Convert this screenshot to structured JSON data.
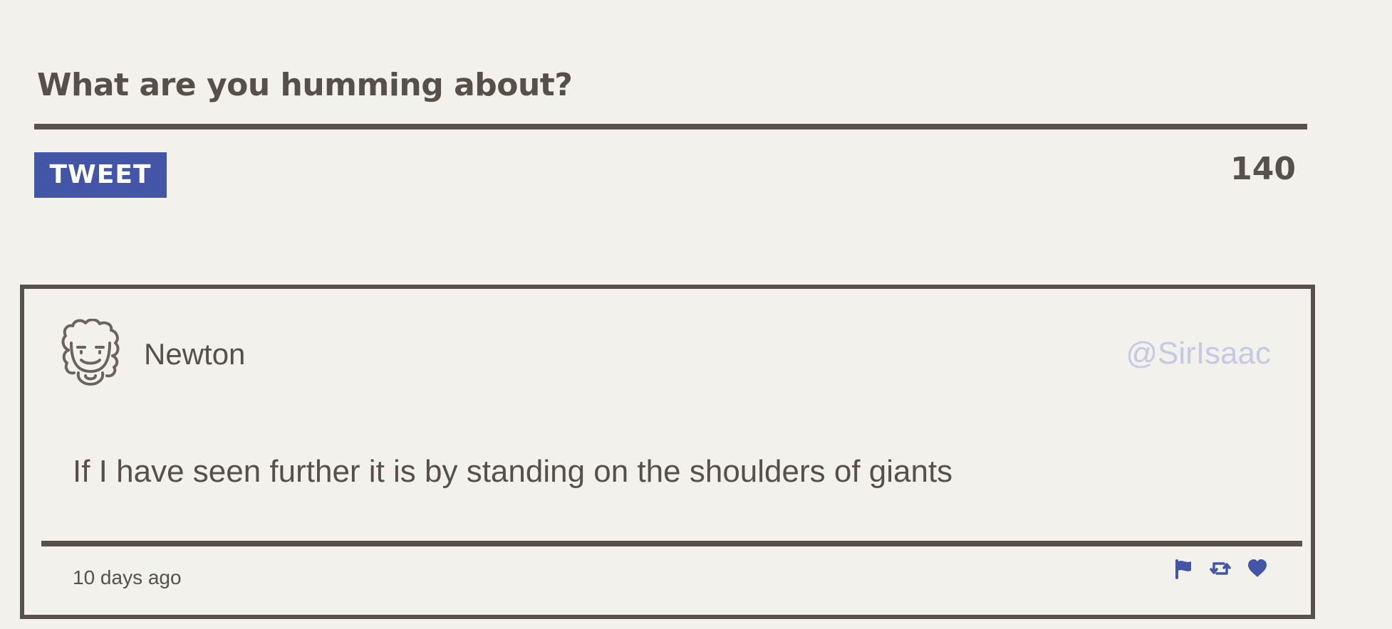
{
  "composer": {
    "prompt": "What are you humming about?",
    "tweet_button_label": "TWEET",
    "char_count": "140"
  },
  "tweet": {
    "author_name": "Newton",
    "handle": "@SirIsaac",
    "text": "If I have seen further it is by standing on the shoulders of giants",
    "timestamp": "10 days ago",
    "actions": [
      {
        "icon": "flag-icon"
      },
      {
        "icon": "retweet-icon"
      },
      {
        "icon": "heart-icon"
      }
    ]
  },
  "colors": {
    "accent": "#4355a7",
    "text": "#565049",
    "handle": "#c5c9e3",
    "background": "#f3f1ec"
  }
}
